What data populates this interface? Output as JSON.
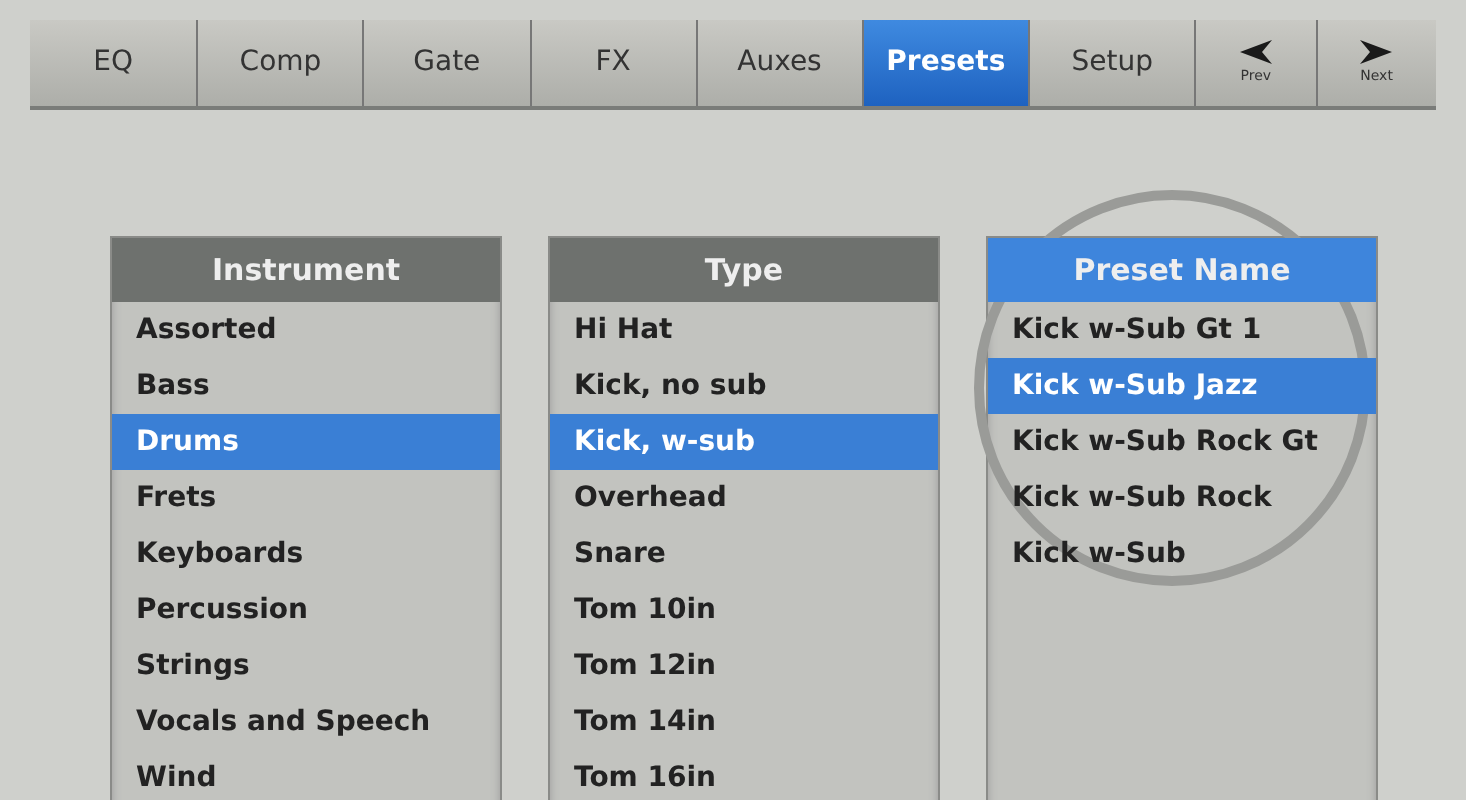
{
  "tabs": [
    {
      "kind": "tab",
      "label": "EQ",
      "selected": false
    },
    {
      "kind": "tab",
      "label": "Comp",
      "selected": false
    },
    {
      "kind": "tab",
      "label": "Gate",
      "selected": false
    },
    {
      "kind": "tab",
      "label": "FX",
      "selected": false
    },
    {
      "kind": "tab",
      "label": "Auxes",
      "selected": false
    },
    {
      "kind": "tab",
      "label": "Presets",
      "selected": true
    },
    {
      "kind": "tab",
      "label": "Setup",
      "selected": false
    },
    {
      "kind": "prev",
      "label": "Prev",
      "selected": false
    },
    {
      "kind": "next",
      "label": "Next",
      "selected": false
    }
  ],
  "lists": [
    {
      "header": "Instrument",
      "header_selected": false,
      "items": [
        {
          "label": "Assorted",
          "selected": false
        },
        {
          "label": "Bass",
          "selected": false
        },
        {
          "label": "Drums",
          "selected": true
        },
        {
          "label": "Frets",
          "selected": false
        },
        {
          "label": "Keyboards",
          "selected": false
        },
        {
          "label": "Percussion",
          "selected": false
        },
        {
          "label": "Strings",
          "selected": false
        },
        {
          "label": "Vocals and Speech",
          "selected": false
        },
        {
          "label": "Wind",
          "selected": false
        }
      ]
    },
    {
      "header": "Type",
      "header_selected": false,
      "items": [
        {
          "label": "Hi Hat",
          "selected": false
        },
        {
          "label": "Kick, no sub",
          "selected": false
        },
        {
          "label": "Kick, w-sub",
          "selected": true
        },
        {
          "label": "Overhead",
          "selected": false
        },
        {
          "label": "Snare",
          "selected": false
        },
        {
          "label": "Tom 10in",
          "selected": false
        },
        {
          "label": "Tom 12in",
          "selected": false
        },
        {
          "label": "Tom 14in",
          "selected": false
        },
        {
          "label": "Tom 16in",
          "selected": false
        }
      ]
    },
    {
      "header": "Preset Name",
      "header_selected": true,
      "items": [
        {
          "label": "Kick w-Sub Gt 1",
          "selected": false
        },
        {
          "label": "Kick w-Sub Jazz",
          "selected": true
        },
        {
          "label": "Kick w-Sub Rock Gt",
          "selected": false
        },
        {
          "label": "Kick w-Sub Rock",
          "selected": false
        },
        {
          "label": "Kick w-Sub",
          "selected": false
        }
      ]
    }
  ]
}
